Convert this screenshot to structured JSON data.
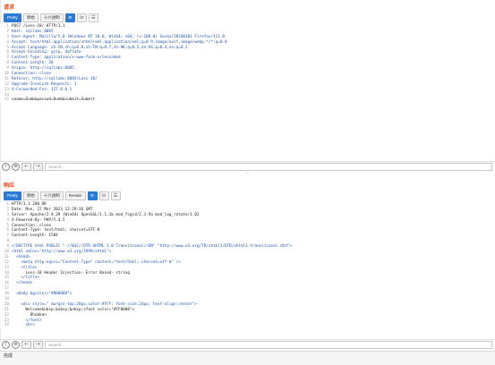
{
  "request": {
    "title": "请求",
    "tabs": [
      "Pretty",
      "原始",
      "十六进制"
    ],
    "active_tab": 0,
    "icons": [
      "list-icon",
      "newline-icon",
      "menu-icon"
    ],
    "lines": [
      "POST /Less-18/ HTTP/1.1",
      "Host: sqllabs:8085",
      "User-Agent: Mozilla/5.0 (Windows NT 10.0; Win64; x64; rv:108.0) Gecko/20100101 Firefox/111.0",
      "Accept: text/html,application/xhtml+xml,application/xml;q=0.9,image/avif,image/webp,*/*;q=0.8",
      "Accept-Language: zh-CN,zh;q=0.8,zh-TW;q=0.7,zh-HK;q=0.5,en-US;q=0.3,en;q=0.2",
      "Accept-Encoding: gzip, deflate",
      "Content-Type: application/x-www-form-urlencoded",
      "Content-Length: 38",
      "Origin: http://sqllabs:8085",
      "Connection: close",
      "Referer: http://sqllabs:8085/Less-18/",
      "Upgrade-Insecure-Requests: 1",
      "X-Forwarded-For: 127.0.0.1",
      "",
      "uname=Dumb&passwd=Dumb&submit=Submit"
    ],
    "search_placeholder": "Search..."
  },
  "splitter": "...",
  "response": {
    "title": "响应",
    "tabs": [
      "Pretty",
      "原始",
      "十六进制",
      "Render"
    ],
    "active_tab": 0,
    "icons": [
      "list-icon",
      "newline-icon",
      "menu-icon"
    ],
    "lines": [
      "HTTP/1.1 200 OK",
      "Date: Mon, 27 Mar 2023 12:29:16 GMT",
      "Server: Apache/2.4.39 (Win64) OpenSSL/1.1.1b mod_fcgid/2.3.9a mod_log_rotate/1.02",
      "X-Powered-By: PHP/5.4.5",
      "Connection: close",
      "Content-Type: text/html; charset=UTF-8",
      "Content-Length: 1584",
      "",
      "<!DOCTYPE html PUBLIC \"-//W3C//DTD XHTML 1.0 Transitional//EN\" \"http://www.w3.org/TR/xhtml1/DTD/xhtml1-transitional.dtd\">",
      "<html xmlns=\"http://www.w3.org/1999/xhtml\">",
      "  <head>",
      "    <meta http-equiv=\"Content-Type\" content=\"text/html; charset=utf-8\" />",
      "    <title>",
      "      Less-18 Header Injection- Error Based- string",
      "    </title>",
      "  </head>",
      "",
      "  <body bgcolor=\"#000000\">",
      "",
      "    <div style=\" margin-top:20px;color:#FFF; font-size:24px; text-align:center\">",
      "      Welcome&nbsp;&nbsp;&nbsp;<font color=\"#FF0000\">",
      "        Dhakkan",
      "      </font>",
      "      <br>"
    ],
    "search_placeholder": "Search..."
  },
  "status": "完成",
  "colors": {
    "accent": "#2b7bd6",
    "title": "#e8471b"
  }
}
